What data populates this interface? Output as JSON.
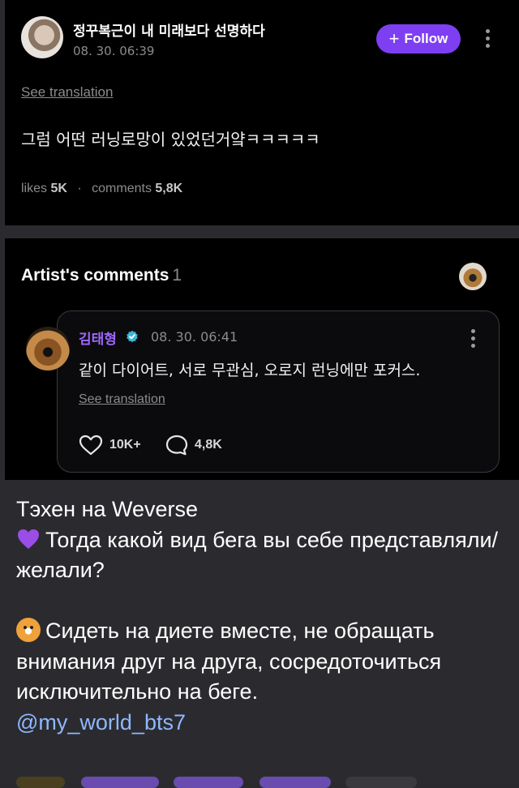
{
  "post": {
    "username": "정꾸복근이 내 미래보다 선명하다",
    "timestamp": "08. 30. 06:39",
    "follow_label": "Follow",
    "see_translation": "See translation",
    "text": "그럼 어떤 러닝로망이 있었던거얔ㅋㅋㅋㅋㅋ",
    "likes_label": "likes",
    "likes_count": "5K",
    "comments_label": "comments",
    "comments_count": "5,8K"
  },
  "artist_comments": {
    "heading": "Artist's comments",
    "count": "1",
    "comment": {
      "author": "김태형",
      "timestamp": "08. 30. 06:41",
      "text": "같이 다이어트, 서로 무관심, 오로지 런닝에만 포커스.",
      "see_translation": "See translation",
      "likes": "10K+",
      "replies": "4,8K"
    }
  },
  "caption": {
    "line1": "Тэхен на Weverse",
    "question": "Тогда какой вид бега вы себе представляли/желали?",
    "answer": "Сидеть на диете вместе, не обращать внимания друг на друга, сосредоточиться исключительно на беге.",
    "link": "@my_world_bts7"
  },
  "colors": {
    "accent": "#7e3ff2",
    "artist_name": "#a066ff",
    "link": "#8fb7ff"
  }
}
